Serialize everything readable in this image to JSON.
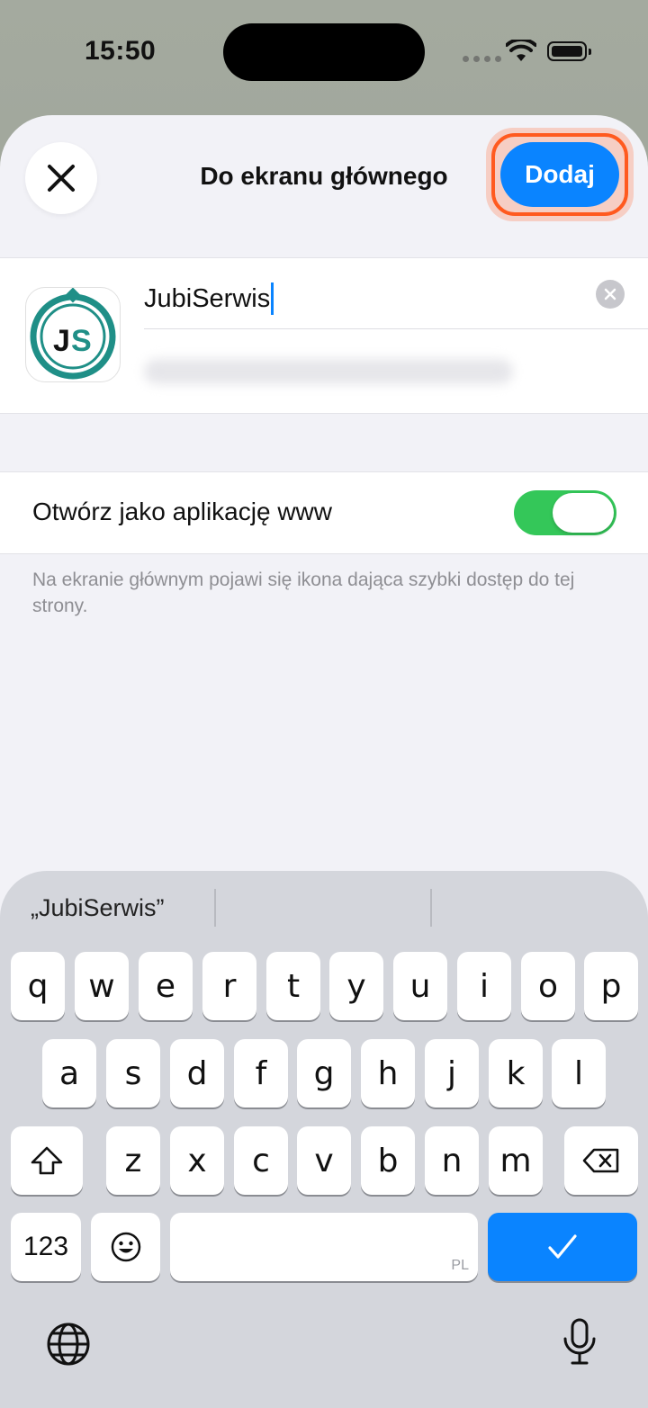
{
  "status": {
    "time": "15:50"
  },
  "sheet": {
    "title": "Do ekranu głównego",
    "add_label": "Dodaj",
    "close_icon": "close-icon"
  },
  "bookmark": {
    "name": "JubiSerwis",
    "icon_text_j": "J",
    "icon_text_s": "S"
  },
  "options": {
    "web_app_label": "Otwórz jako aplikację www",
    "web_app_enabled": true,
    "hint": "Na ekranie głównym pojawi się ikona dająca szybki dostęp do tej strony."
  },
  "keyboard": {
    "suggestion": "„JubiSerwis”",
    "row1": [
      "q",
      "w",
      "e",
      "r",
      "t",
      "y",
      "u",
      "i",
      "o",
      "p"
    ],
    "row2": [
      "a",
      "s",
      "d",
      "f",
      "g",
      "h",
      "j",
      "k",
      "l"
    ],
    "row3": [
      "z",
      "x",
      "c",
      "v",
      "b",
      "n",
      "m"
    ],
    "numbers_label": "123",
    "language": "PL"
  },
  "colors": {
    "accent": "#0a84ff",
    "toggle_on": "#34c759",
    "highlight": "#ff5a1f"
  }
}
